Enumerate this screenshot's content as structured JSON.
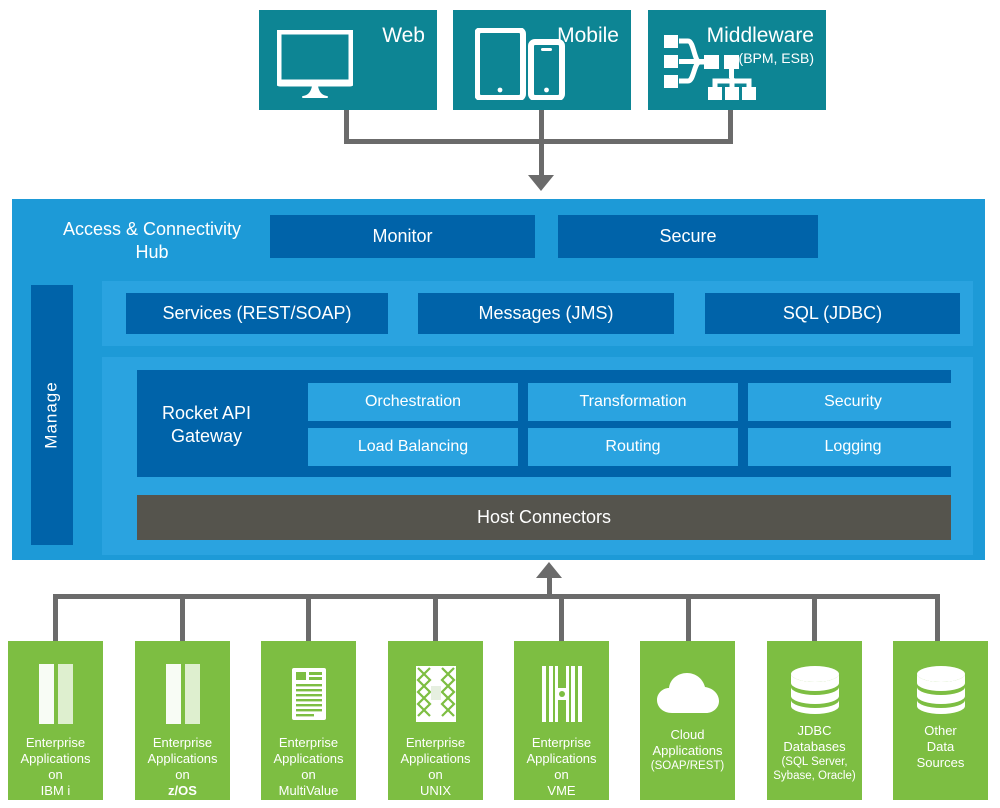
{
  "diagram": {
    "title": "Access & Connectivity Hub Architecture",
    "colors": {
      "teal": "#0D8594",
      "hub_blue": "#1D9AD7",
      "dark_blue": "#0063A9",
      "mid_blue": "#2AA3E0",
      "green": "#7DBE42",
      "gray_connector": "#6B6B6B",
      "host_connector_gray": "#55544D",
      "white": "#FFFFFF"
    }
  },
  "channels": [
    {
      "label": "Web",
      "sub": "",
      "icon": "desktop-monitor-icon"
    },
    {
      "label": "Mobile",
      "sub": "",
      "icon": "tablet-and-phone-icon"
    },
    {
      "label": "Middleware",
      "sub": "(BPM, ESB)",
      "icon": "middleware-network-icon"
    }
  ],
  "hub": {
    "title": "Access & Connectivity\nHub",
    "title_line1": "Access & Connectivity",
    "title_line2": "Hub",
    "manage_label": "Manage",
    "top_functions": [
      {
        "label": "Monitor"
      },
      {
        "label": "Secure"
      }
    ],
    "protocols": [
      {
        "label": "Services (REST/SOAP)"
      },
      {
        "label": "Messages (JMS)"
      },
      {
        "label": "SQL (JDBC)"
      }
    ],
    "gateway": {
      "label_line1": "Rocket API",
      "label_line2": "Gateway",
      "capabilities_row1": [
        {
          "label": "Orchestration"
        },
        {
          "label": "Transformation"
        },
        {
          "label": "Security"
        }
      ],
      "capabilities_row2": [
        {
          "label": "Load Balancing"
        },
        {
          "label": "Routing"
        },
        {
          "label": "Logging"
        }
      ]
    },
    "host_connectors_label": "Host Connectors"
  },
  "sources": [
    {
      "icon": "server-tower-icon",
      "lines": [
        "Enterprise",
        "Applications",
        "on"
      ],
      "platform": "IBM i",
      "platform_prefix": "",
      "platform_bold": "",
      "sub": ""
    },
    {
      "icon": "server-tower-icon",
      "lines": [
        "Enterprise",
        "Applications",
        "on"
      ],
      "platform": "z/OS",
      "platform_prefix": "",
      "platform_bold": "z",
      "sub": ""
    },
    {
      "icon": "document-list-icon",
      "lines": [
        "Enterprise",
        "Applications",
        "on"
      ],
      "platform": "MultiValue",
      "platform_prefix": "",
      "platform_bold": "",
      "sub": ""
    },
    {
      "icon": "unix-block-icon",
      "lines": [
        "Enterprise",
        "Applications",
        "on"
      ],
      "platform": "UNIX",
      "platform_prefix": "",
      "platform_bold": "",
      "sub": ""
    },
    {
      "icon": "vme-block-icon",
      "lines": [
        "Enterprise",
        "Applications",
        "on"
      ],
      "platform": "VME",
      "platform_prefix": "",
      "platform_bold": "",
      "sub": ""
    },
    {
      "icon": "cloud-icon",
      "lines": [
        "Cloud",
        "Applications"
      ],
      "platform": "",
      "platform_prefix": "",
      "platform_bold": "",
      "sub": "(SOAP/REST)"
    },
    {
      "icon": "database-cylinder-icon",
      "lines": [
        "JDBC",
        "Databases"
      ],
      "platform": "",
      "platform_prefix": "",
      "platform_bold": "",
      "sub": "(SQL Server,\nSybase, Oracle)"
    },
    {
      "icon": "database-cylinder-icon",
      "lines": [
        "Other",
        "Data",
        "Sources"
      ],
      "platform": "",
      "platform_prefix": "",
      "platform_bold": "",
      "sub": ""
    }
  ]
}
